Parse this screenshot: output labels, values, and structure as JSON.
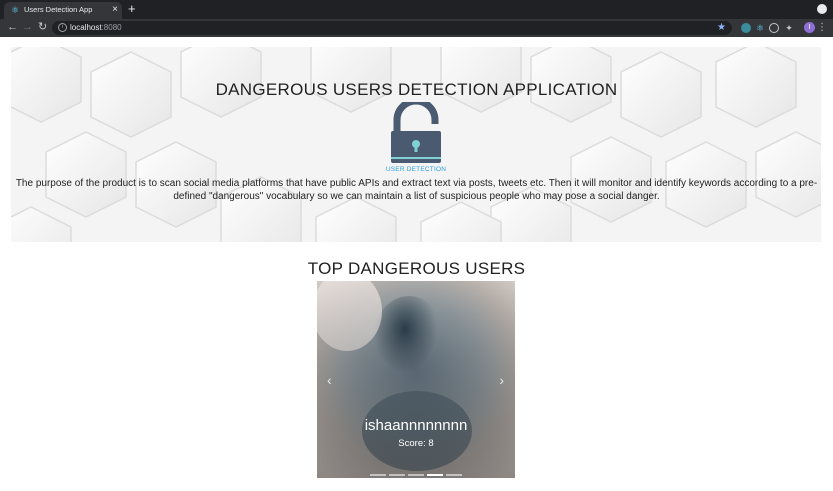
{
  "browser": {
    "tab_title": "Users Detection App",
    "url_host": "localhost",
    "url_port": ":8080",
    "profile_initial": "I"
  },
  "page": {
    "title": "DANGEROUS USERS DETECTION APPLICATION",
    "logo_caption": "USER DETECTION",
    "description": "The purpose of the product is to scan social media platforms that have public APIs and extract text via posts, tweets etc. Then it will monitor and identify keywords according to a pre-defined \"dangerous\" vocabulary so we can maintain a list of suspicious people who may pose a social danger.",
    "section_title": "TOP DANGEROUS USERS"
  },
  "carousel": {
    "username": "ishaannnnnnnn",
    "score_label": "Score: 8",
    "indicator_count": 5,
    "active_indicator": 3
  },
  "icons": {
    "favicon": "react-icon",
    "logo": "unlocked-padlock-icon",
    "prev": "chevron-left-icon",
    "next": "chevron-right-icon"
  },
  "colors": {
    "lock_body": "#4a5a70",
    "lock_accent": "#7fd1d6",
    "caption": "#2f9fd6"
  }
}
